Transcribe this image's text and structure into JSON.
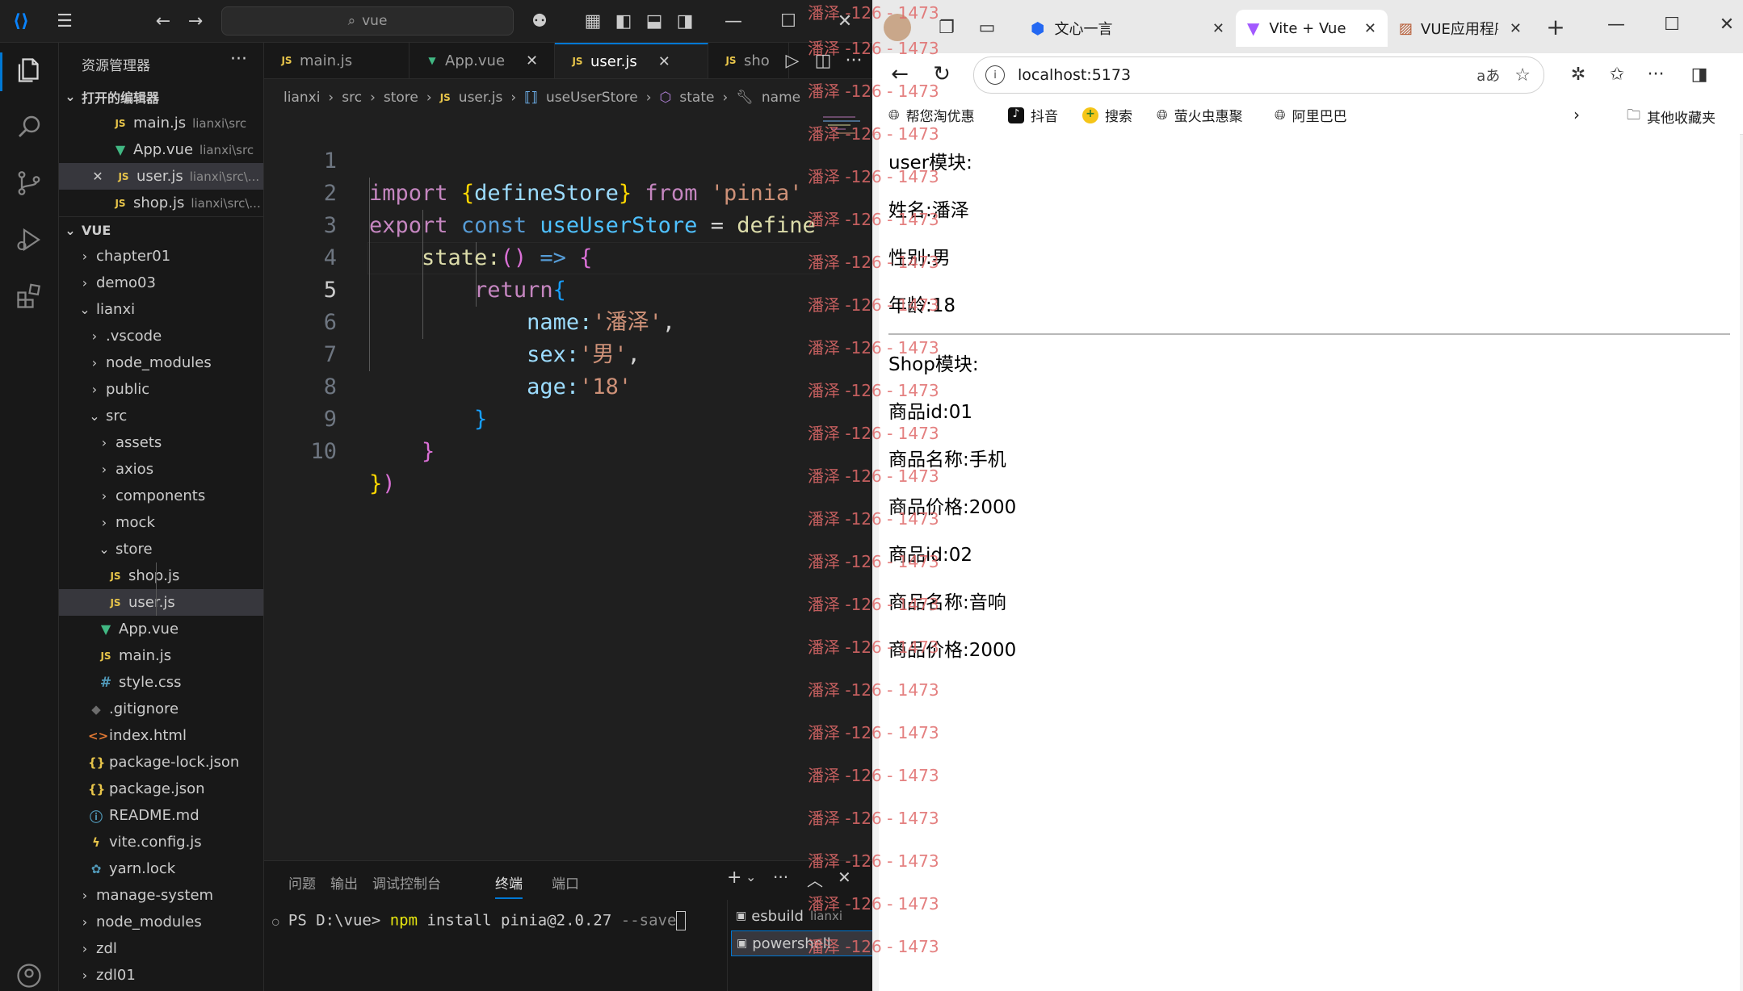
{
  "titlebar": {
    "search_text": "vue"
  },
  "sidebar": {
    "title": "资源管理器",
    "open_editors_label": "打开的编辑器",
    "open_editors": [
      {
        "name": "main.js",
        "path": "lianxi\\src",
        "type": "js"
      },
      {
        "name": "App.vue",
        "path": "lianxi\\src",
        "type": "vue"
      },
      {
        "name": "user.js",
        "path": "lianxi\\src\\...",
        "type": "js"
      },
      {
        "name": "shop.js",
        "path": "lianxi\\src\\...",
        "type": "js"
      }
    ],
    "workspace_label": "VUE",
    "tree": [
      {
        "name": "chapter01"
      },
      {
        "name": "demo03"
      },
      {
        "name": "lianxi"
      },
      {
        "name": ".vscode"
      },
      {
        "name": "node_modules"
      },
      {
        "name": "public"
      },
      {
        "name": "src"
      },
      {
        "name": "assets"
      },
      {
        "name": "axios"
      },
      {
        "name": "components"
      },
      {
        "name": "mock"
      },
      {
        "name": "store"
      },
      {
        "name": "shop.js"
      },
      {
        "name": "user.js"
      },
      {
        "name": "App.vue"
      },
      {
        "name": "main.js"
      },
      {
        "name": "style.css"
      },
      {
        "name": ".gitignore"
      },
      {
        "name": "index.html"
      },
      {
        "name": "package-lock.json"
      },
      {
        "name": "package.json"
      },
      {
        "name": "README.md"
      },
      {
        "name": "vite.config.js"
      },
      {
        "name": "yarn.lock"
      },
      {
        "name": "manage-system"
      },
      {
        "name": "node_modules"
      },
      {
        "name": "zdl"
      },
      {
        "name": "zdl01"
      }
    ]
  },
  "editor": {
    "tabs": [
      {
        "label": "main.js"
      },
      {
        "label": "App.vue"
      },
      {
        "label": "user.js"
      },
      {
        "label": "sho"
      }
    ],
    "breadcrumb": [
      "lianxi",
      "src",
      "store",
      "user.js",
      "useUserStore",
      "state",
      "name"
    ],
    "line_numbers": [
      "1",
      "2",
      "3",
      "4",
      "5",
      "6",
      "7",
      "8",
      "9",
      "10"
    ],
    "code": {
      "l1_import": "import",
      "l1_brace_open": "{",
      "l1_ident": "defineStore",
      "l1_brace_close": "}",
      "l1_from": "from",
      "l1_str": "'pinia'",
      "l2_export": "export",
      "l2_const": "const",
      "l2_name": "useUserStore",
      "l2_eq": "=",
      "l2_fn": "define",
      "l3_state": "state:",
      "l3_parens": "()",
      "l3_arrow": "=>",
      "l3_brace": "{",
      "l4_return": "return",
      "l4_brace": "{",
      "l5_key": "name:",
      "l5_val": "'潘泽'",
      "l5_comma": ",",
      "l6_key": "sex:",
      "l6_val": "'男'",
      "l6_comma": ",",
      "l7_key": "age:",
      "l7_val": "'18'",
      "l8_brace": "}",
      "l9_brace": "}",
      "l10_brace": "}",
      "l10_paren": ")"
    }
  },
  "panel": {
    "tabs": [
      "问题",
      "输出",
      "调试控制台",
      "终端",
      "端口"
    ],
    "terminal_prompt": "PS D:\\vue>",
    "terminal_cmd": "npm",
    "terminal_args": "install pinia@2.0.27",
    "terminal_flag": "--save",
    "terminals": [
      {
        "name": "esbuild",
        "sub": "lianxi"
      },
      {
        "name": "powershell"
      }
    ]
  },
  "browser": {
    "tabs": [
      {
        "label": "文心一言"
      },
      {
        "label": "Vite + Vue"
      },
      {
        "label": "VUE应用程序"
      }
    ],
    "address": "localhost:5173",
    "favorites": [
      "帮您淘优惠",
      "抖音",
      "搜索",
      "萤火虫惠聚",
      "阿里巴巴"
    ],
    "other_favorites": "其他收藏夹",
    "page": {
      "user_title": "user模块:",
      "user_name": "姓名:潘泽",
      "user_sex": "性别:男",
      "user_age": "年龄:18",
      "shop_title": "Shop模块:",
      "items": [
        "商品id:01",
        "商品名称:手机",
        "商品价格:2000",
        "商品id:02",
        "商品名称:音响",
        "商品价格:2000"
      ]
    }
  },
  "watermark": "潘泽 -126 - 1473",
  "colors": {
    "accent": "#0078d4",
    "editor_bg": "#1f1f1f",
    "keyword": "#c586c0",
    "string": "#ce9178",
    "watermark": "#e06a6a"
  }
}
